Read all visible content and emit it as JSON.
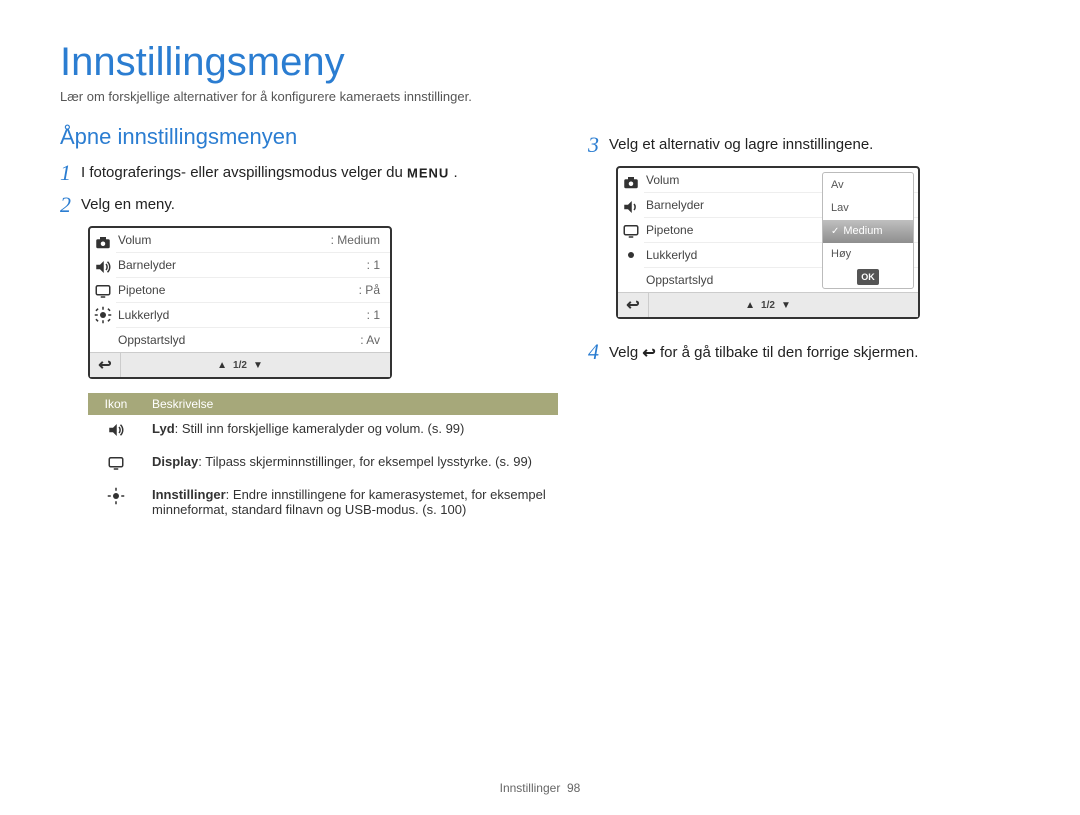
{
  "title": "Innstillingsmeny",
  "subtitle": "Lær om forskjellige alternativer for å konfigurere kameraets innstillinger.",
  "section_title": "Åpne innstillingsmenyen",
  "steps": {
    "s1a": "I fotograferings- eller avspillingsmodus velger du ",
    "s1b": ".",
    "menu": "MENU",
    "s2": "Velg en meny.",
    "s3": "Velg et alternativ og lagre innstillingene.",
    "s4a": "Velg ",
    "s4b": " for å gå tilbake til den forrige skjermen."
  },
  "screen1": {
    "rows": [
      {
        "label": "Volum",
        "value": ": Medium"
      },
      {
        "label": "Barnelyder",
        "value": ": 1"
      },
      {
        "label": "Pipetone",
        "value": ": På"
      },
      {
        "label": "Lukkerlyd",
        "value": ": 1"
      },
      {
        "label": "Oppstartslyd",
        "value": ": Av"
      }
    ],
    "page": "1/2"
  },
  "table": {
    "h_icon": "Ikon",
    "h_desc": "Beskrivelse",
    "r1b": "Lyd",
    "r1": ": Still inn forskjellige kameralyder og volum. (s. 99)",
    "r2b": "Display",
    "r2": ": Tilpass skjerminnstillinger, for eksempel lysstyrke. (s. 99)",
    "r3b": "Innstillinger",
    "r3": ": Endre innstillingene for kamerasystemet, for eksempel minneformat, standard filnavn og USB-modus. (s. 100)"
  },
  "screen2": {
    "rows": [
      {
        "label": "Volum"
      },
      {
        "label": "Barnelyder"
      },
      {
        "label": "Pipetone"
      },
      {
        "label": "Lukkerlyd"
      },
      {
        "label": "Oppstartslyd"
      }
    ],
    "opts": {
      "o1": "Av",
      "o2": "Lav",
      "o3": "Medium",
      "o4": "Høy"
    },
    "ok": "OK",
    "page": "1/2"
  },
  "footer": {
    "label": "Innstillinger",
    "page": "98"
  }
}
